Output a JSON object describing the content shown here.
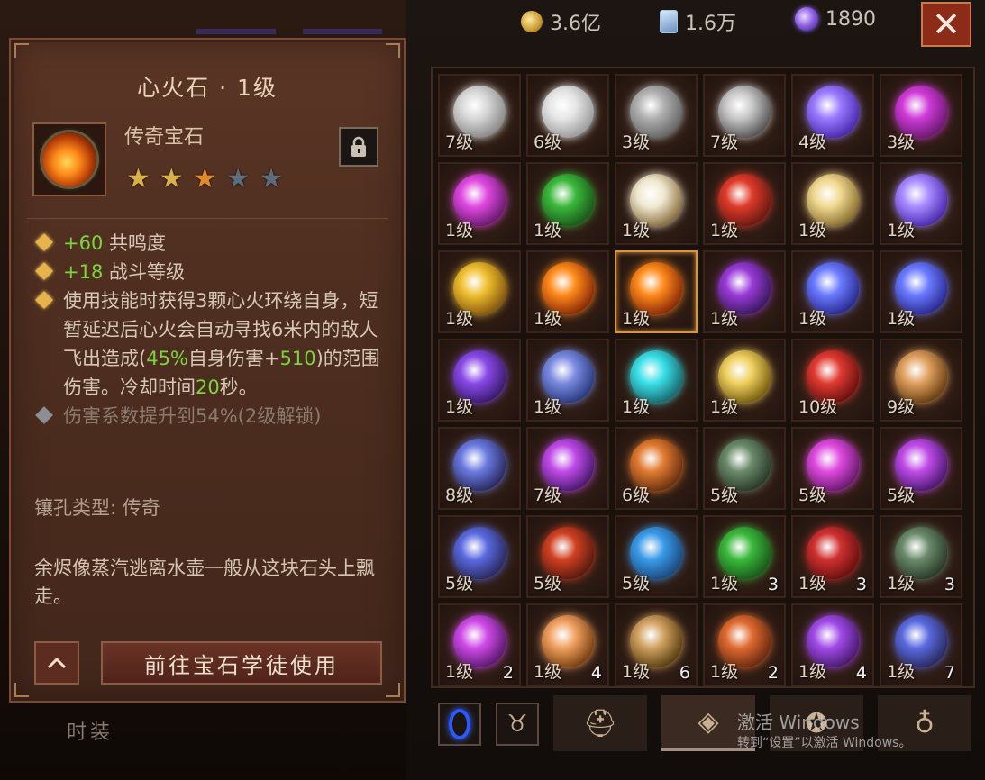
{
  "currency": [
    {
      "icon": "gold-coin-icon",
      "value": "3.6亿"
    },
    {
      "icon": "platinum-card-icon",
      "value": "1.6万"
    },
    {
      "icon": "eternal-orb-icon",
      "value": "1890"
    }
  ],
  "close_label": "✕",
  "tooltip": {
    "title": "心火石 · 1级",
    "gem_type": "传奇宝石",
    "stars": {
      "filled": 3,
      "total": 5
    },
    "lock_icon": "lock-icon",
    "effects": [
      {
        "prefix": "+",
        "value": "60",
        "text": " 共鸣度"
      },
      {
        "prefix": "+",
        "value": "18",
        "text": " 战斗等级"
      }
    ],
    "desc_parts": [
      "使用技能时获得3颗心火环绕自身，短暂延迟后心火会自动寻找6米内的敌人飞出造成(",
      "45%",
      "自身伤害+",
      "510",
      ")的范围伤害。冷却时间",
      "20",
      "秒。"
    ],
    "locked_effect": "伤害系数提升到54%(2级解锁)",
    "socket_type": "镶孔类型:  传奇",
    "flavor": "余烬像蒸汽逃离水壶一般从这块石头上飘走。",
    "up_label": "^",
    "goto_label": "前往宝石学徒使用"
  },
  "fashion_label": "时装",
  "gems": [
    {
      "level": "7级",
      "count": "",
      "color": "#d8d8d8",
      "glow": "#888888"
    },
    {
      "level": "6级",
      "count": "",
      "color": "#e6e6e6",
      "glow": "#9a9a9a"
    },
    {
      "level": "3级",
      "count": "",
      "color": "#b0b0b0",
      "glow": "#666666"
    },
    {
      "level": "7级",
      "count": "",
      "color": "#c8c8c8",
      "glow": "#555555"
    },
    {
      "level": "4级",
      "count": "",
      "color": "#9a7aff",
      "glow": "#4a2ab0"
    },
    {
      "level": "3级",
      "count": "",
      "color": "#d03ad8",
      "glow": "#6a1a70"
    },
    {
      "level": "1级",
      "count": "",
      "color": "#e048e0",
      "glow": "#6a1a70"
    },
    {
      "level": "1级",
      "count": "",
      "color": "#3ab83a",
      "glow": "#1a5a1a"
    },
    {
      "level": "1级",
      "count": "",
      "color": "#f0e8d0",
      "glow": "#8a7040"
    },
    {
      "level": "1级",
      "count": "",
      "color": "#e03a2a",
      "glow": "#6a1a10"
    },
    {
      "level": "1级",
      "count": "",
      "color": "#f0d890",
      "glow": "#8a7030"
    },
    {
      "level": "1级",
      "count": "",
      "color": "#a88aff",
      "glow": "#4a2ab0"
    },
    {
      "level": "1级",
      "count": "",
      "color": "#f0c030",
      "glow": "#8a5a10"
    },
    {
      "level": "1级",
      "count": "",
      "color": "#ff8a1a",
      "glow": "#8a2a08"
    },
    {
      "level": "1级",
      "count": "",
      "color": "#ff8a1a",
      "glow": "#8a2a08"
    },
    {
      "level": "1级",
      "count": "",
      "color": "#9a3ad8",
      "glow": "#3a1a60"
    },
    {
      "level": "1级",
      "count": "",
      "color": "#6a7aff",
      "glow": "#2a2a90"
    },
    {
      "level": "1级",
      "count": "",
      "color": "#6a7aff",
      "glow": "#2a2a90"
    },
    {
      "level": "1级",
      "count": "",
      "color": "#8a4ae8",
      "glow": "#3a1a70"
    },
    {
      "level": "1级",
      "count": "",
      "color": "#7a8ae0",
      "glow": "#2a3a80"
    },
    {
      "level": "1级",
      "count": "",
      "color": "#3ae0e8",
      "glow": "#1a6a70"
    },
    {
      "level": "1级",
      "count": "",
      "color": "#f0d060",
      "glow": "#7a6010"
    },
    {
      "level": "10级",
      "count": "",
      "color": "#e03a30",
      "glow": "#6a1010"
    },
    {
      "level": "9级",
      "count": "",
      "color": "#e0a060",
      "glow": "#6a4010"
    },
    {
      "level": "8级",
      "count": "",
      "color": "#6a7ae0",
      "glow": "#2a2a60"
    },
    {
      "level": "7级",
      "count": "",
      "color": "#c04ae8",
      "glow": "#4a1a70"
    },
    {
      "level": "6级",
      "count": "",
      "color": "#e07a30",
      "glow": "#6a3010"
    },
    {
      "level": "5级",
      "count": "",
      "color": "#6a8a6a",
      "glow": "#2a3a2a"
    },
    {
      "level": "5级",
      "count": "",
      "color": "#e04ae0",
      "glow": "#6a1a70"
    },
    {
      "level": "5级",
      "count": "",
      "color": "#c04ae8",
      "glow": "#4a1a70"
    },
    {
      "level": "5级",
      "count": "",
      "color": "#5a6ae0",
      "glow": "#2a2a60"
    },
    {
      "level": "5级",
      "count": "",
      "color": "#d04020",
      "glow": "#5a1a10"
    },
    {
      "level": "5级",
      "count": "",
      "color": "#3a9ae8",
      "glow": "#1a4a80"
    },
    {
      "level": "1级",
      "count": "3",
      "color": "#3ab83a",
      "glow": "#1a5a1a"
    },
    {
      "level": "1级",
      "count": "3",
      "color": "#d03030",
      "glow": "#6a1010"
    },
    {
      "level": "1级",
      "count": "3",
      "color": "#6a8a6a",
      "glow": "#2a3a2a"
    },
    {
      "level": "1级",
      "count": "2",
      "color": "#d04ae8",
      "glow": "#5a1a70"
    },
    {
      "level": "1级",
      "count": "4",
      "color": "#f0a060",
      "glow": "#7a4010"
    },
    {
      "level": "1级",
      "count": "6",
      "color": "#d0a060",
      "glow": "#5a4010"
    },
    {
      "level": "1级",
      "count": "2",
      "color": "#e06a30",
      "glow": "#6a2a10"
    },
    {
      "level": "1级",
      "count": "4",
      "color": "#a04ae8",
      "glow": "#4a1a70"
    },
    {
      "level": "1级",
      "count": "7",
      "color": "#5a6ae0",
      "glow": "#2a2a60"
    }
  ],
  "selected_index": 14,
  "bottom_tabs": {
    "small": [
      "sapphire-icon",
      "demon-face-icon"
    ],
    "big": [
      "helmet-icon",
      "gem-tab-icon",
      "gear-tab-icon",
      "bag-icon"
    ],
    "active": 1
  },
  "watermark": {
    "line1": "激活 Windows",
    "line2": "转到“设置”以激活 Windows。"
  }
}
